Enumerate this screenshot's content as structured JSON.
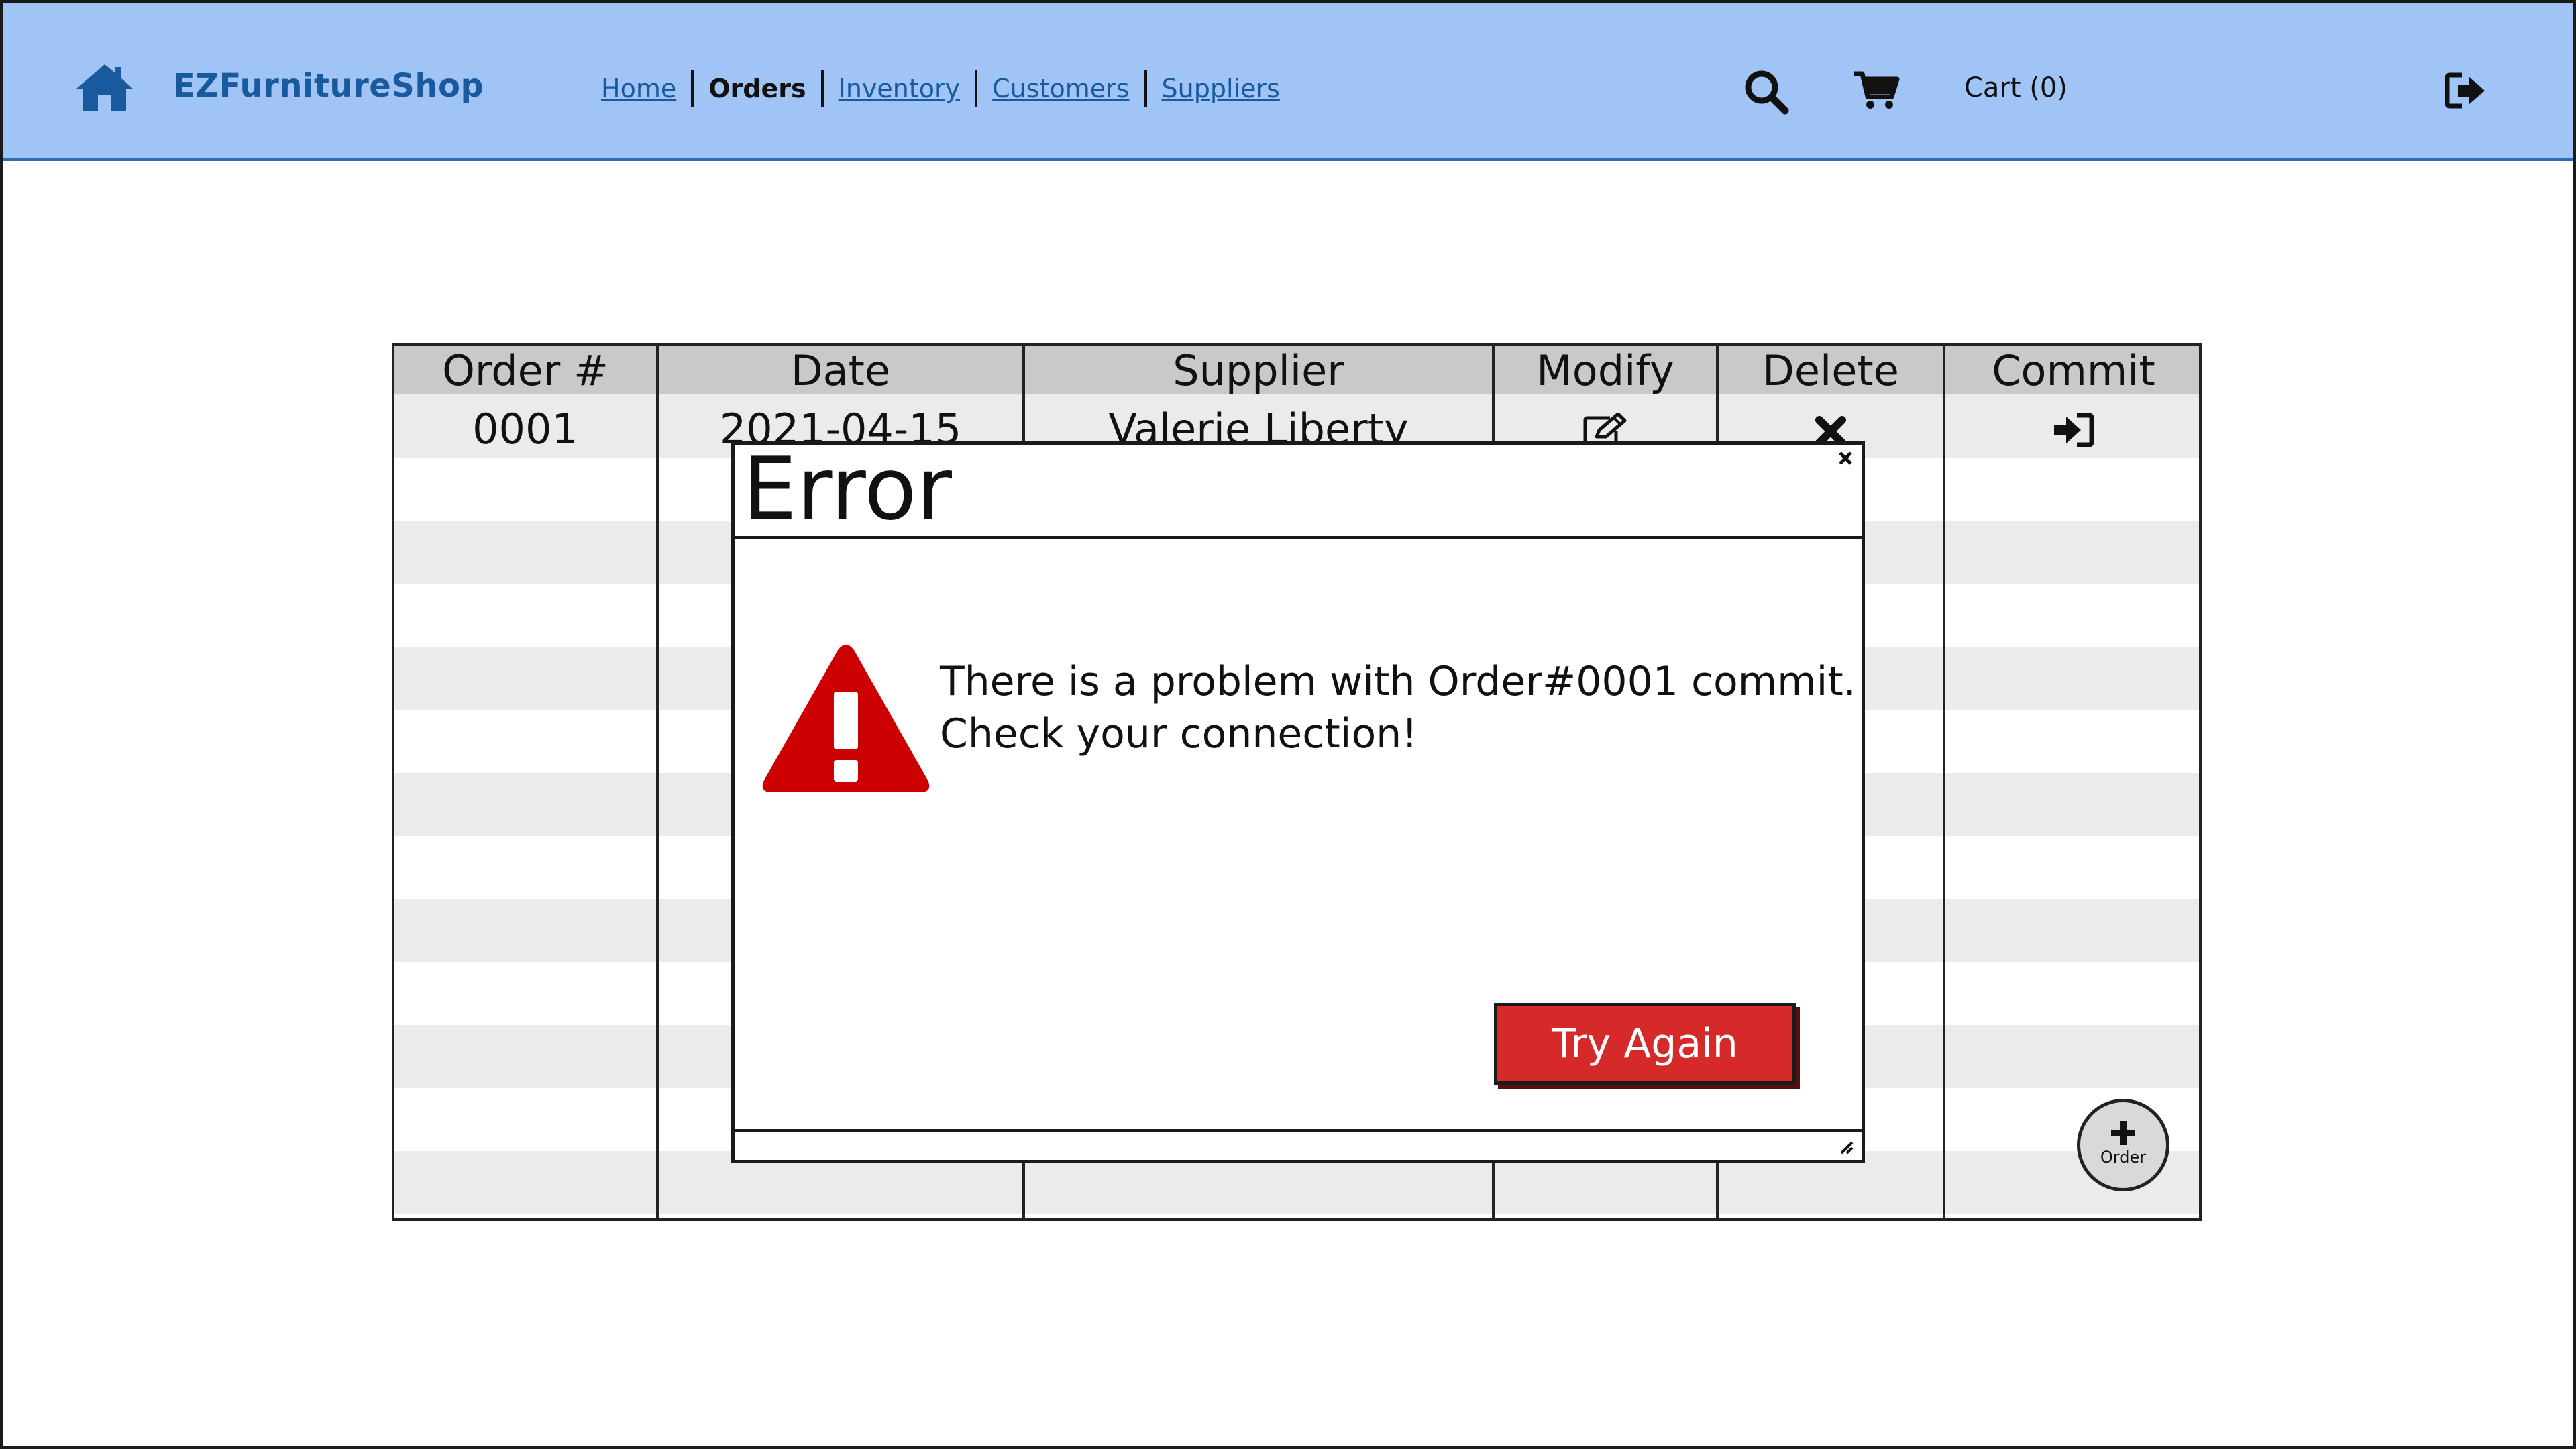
{
  "app": {
    "brand": "EZFurnitureShop",
    "accent_color": "#a1c4f6",
    "brand_color": "#185a9d"
  },
  "nav": {
    "items": [
      {
        "label": "Home",
        "active": false
      },
      {
        "label": "Orders",
        "active": true
      },
      {
        "label": "Inventory",
        "active": false
      },
      {
        "label": "Customers",
        "active": false
      },
      {
        "label": "Suppliers",
        "active": false
      }
    ]
  },
  "header": {
    "cart_label": "Cart (0)",
    "icons": [
      "home-icon",
      "search-icon",
      "cart-icon",
      "logout-icon"
    ]
  },
  "table": {
    "columns": [
      "Order #",
      "Date",
      "Supplier",
      "Modify",
      "Delete",
      "Commit"
    ],
    "rows": [
      {
        "order": "0001",
        "date": "2021-04-15",
        "supplier": "Valerie Liberty",
        "modify_icon": "edit-icon",
        "delete_icon": "delete-icon",
        "commit_icon": "commit-icon"
      }
    ]
  },
  "fab": {
    "label": "Order",
    "icon": "plus-icon"
  },
  "dialog": {
    "title": "Error",
    "message_line1": "There is a problem with Order#0001 commit.",
    "message_line2": "Check your connection!",
    "button_label": "Try Again",
    "button_color": "#d62a2a",
    "warning_color": "#cc0000"
  }
}
